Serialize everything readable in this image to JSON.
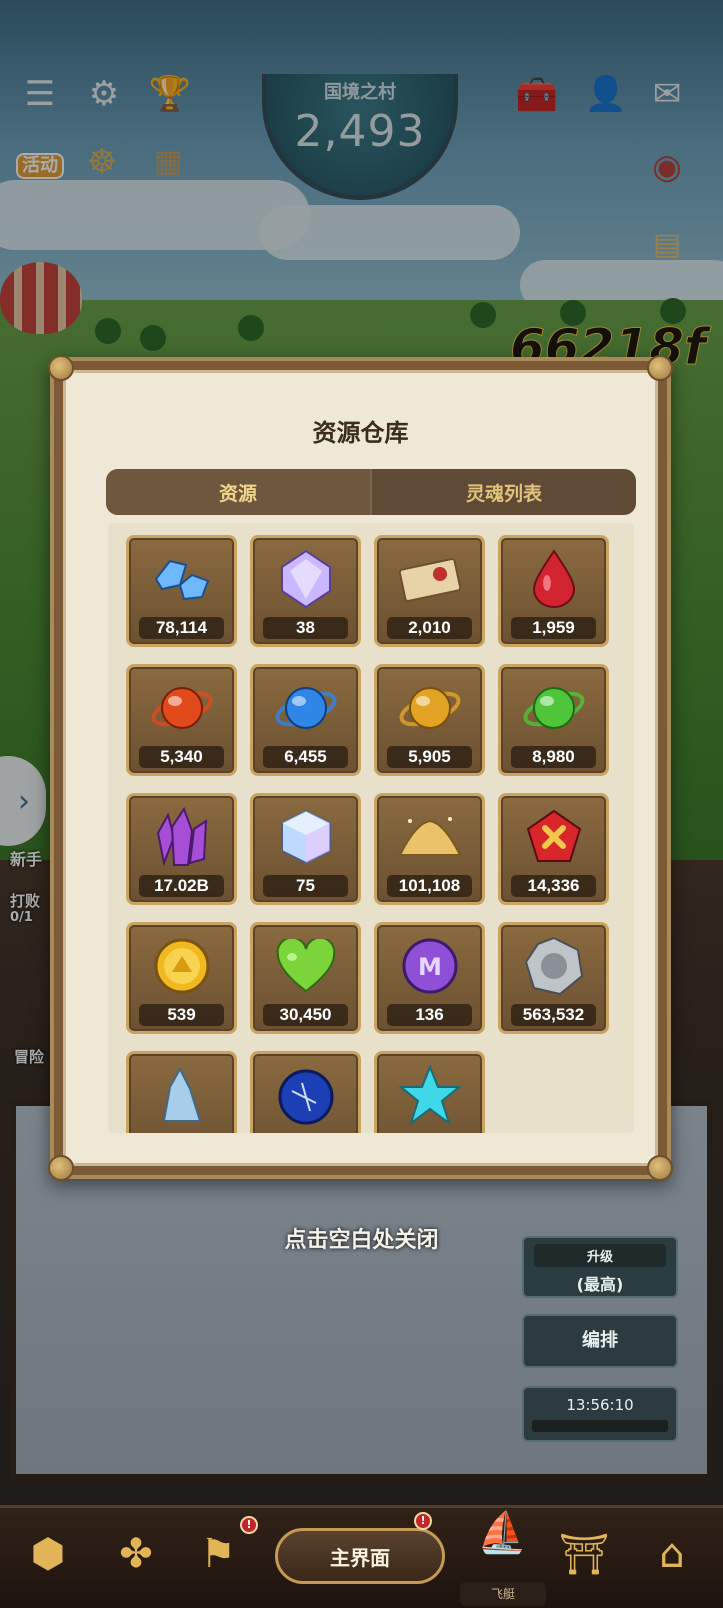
{
  "hud": {
    "region_name": "国境之村",
    "region_score": "2,493",
    "event_label": "活动",
    "big_number": "66218f"
  },
  "left_panel": {
    "quest_title": "新手",
    "quest_text": "打败",
    "quest_progress": "0/1",
    "adventure_label": "冒险"
  },
  "modal": {
    "title": "资源仓库",
    "tabs": [
      {
        "label": "资源",
        "active": true
      },
      {
        "label": "灵魂列表",
        "active": false
      }
    ],
    "items": [
      {
        "icon": "blue-crystal-icon",
        "count": "78,114",
        "color": "#6fb7ff"
      },
      {
        "icon": "prism-gem-icon",
        "count": "38",
        "color": "#c9b7ff"
      },
      {
        "icon": "letter-envelope-icon",
        "count": "2,010",
        "color": "#e7d3a6"
      },
      {
        "icon": "red-gem-icon",
        "count": "1,959",
        "color": "#d1242f"
      },
      {
        "icon": "fire-orb-icon",
        "count": "5,340",
        "color": "#e24a1b"
      },
      {
        "icon": "water-orb-icon",
        "count": "6,455",
        "color": "#2f86e6"
      },
      {
        "icon": "gold-orb-icon",
        "count": "5,905",
        "color": "#e3a425"
      },
      {
        "icon": "green-orb-icon",
        "count": "8,980",
        "color": "#4fc53a"
      },
      {
        "icon": "purple-crystal-icon",
        "count": "17.02B",
        "color": "#a64fd6"
      },
      {
        "icon": "rainbow-cube-icon",
        "count": "75",
        "color": "#bfd9ff"
      },
      {
        "icon": "gold-dust-icon",
        "count": "101,108",
        "color": "#e9c26a"
      },
      {
        "icon": "red-cross-badge-icon",
        "count": "14,336",
        "color": "#d9262b"
      },
      {
        "icon": "gold-coin-icon",
        "count": "539",
        "color": "#f1b820"
      },
      {
        "icon": "green-heart-icon",
        "count": "30,450",
        "color": "#7ad43a"
      },
      {
        "icon": "purple-m-coin-icon",
        "count": "136",
        "color": "#8f4fd6"
      },
      {
        "icon": "silver-medal-icon",
        "count": "563,532",
        "color": "#bfc4c8"
      },
      {
        "icon": "ice-shard-icon",
        "count": "",
        "color": "#a7cdea"
      },
      {
        "icon": "blue-sphere-icon",
        "count": "",
        "color": "#1d3fb6"
      },
      {
        "icon": "cyan-star-icon",
        "count": "",
        "color": "#3fd8e8"
      }
    ]
  },
  "close_hint": "点击空白处关闭",
  "side_buttons": {
    "upgrade_label": "升级",
    "upgrade_sub": "(最高)",
    "arrange_label": "编排",
    "timer": "13:56:10"
  },
  "nav": {
    "main_label": "主界面",
    "fly_label": "飞艇"
  }
}
